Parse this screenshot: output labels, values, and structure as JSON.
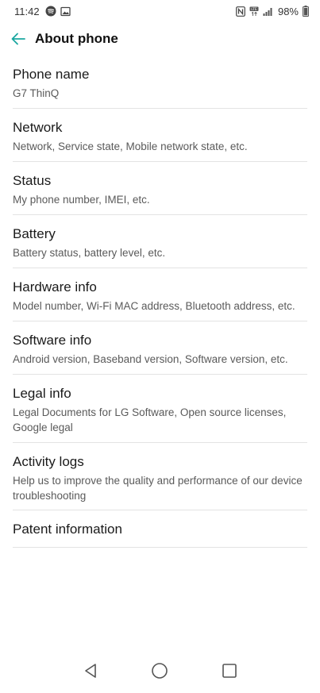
{
  "status_bar": {
    "time": "11:42",
    "battery_pct": "98%",
    "icons_left": [
      "spotify-icon",
      "gallery-notification-icon"
    ],
    "icons_right": [
      "nfc-icon",
      "volte-icon",
      "signal-icon",
      "battery-icon"
    ]
  },
  "header": {
    "title": "About phone",
    "back_icon": "back-arrow-icon",
    "accent_color": "#1ba7a1"
  },
  "items": [
    {
      "title": "Phone name",
      "summary": "G7 ThinQ"
    },
    {
      "title": "Network",
      "summary": "Network, Service state, Mobile network state, etc."
    },
    {
      "title": "Status",
      "summary": "My phone number, IMEI, etc."
    },
    {
      "title": "Battery",
      "summary": "Battery status, battery level, etc."
    },
    {
      "title": "Hardware info",
      "summary": "Model number, Wi-Fi MAC address, Bluetooth address, etc."
    },
    {
      "title": "Software info",
      "summary": "Android version, Baseband version, Software version, etc."
    },
    {
      "title": "Legal info",
      "summary": "Legal Documents for LG Software, Open source licenses, Google legal"
    },
    {
      "title": "Activity logs",
      "summary": "Help us to improve the quality and performance of our device troubleshooting"
    },
    {
      "title": "Patent information",
      "summary": ""
    }
  ],
  "nav_bar": {
    "icons": [
      "back-triangle-icon",
      "home-circle-icon",
      "recents-square-icon"
    ]
  }
}
